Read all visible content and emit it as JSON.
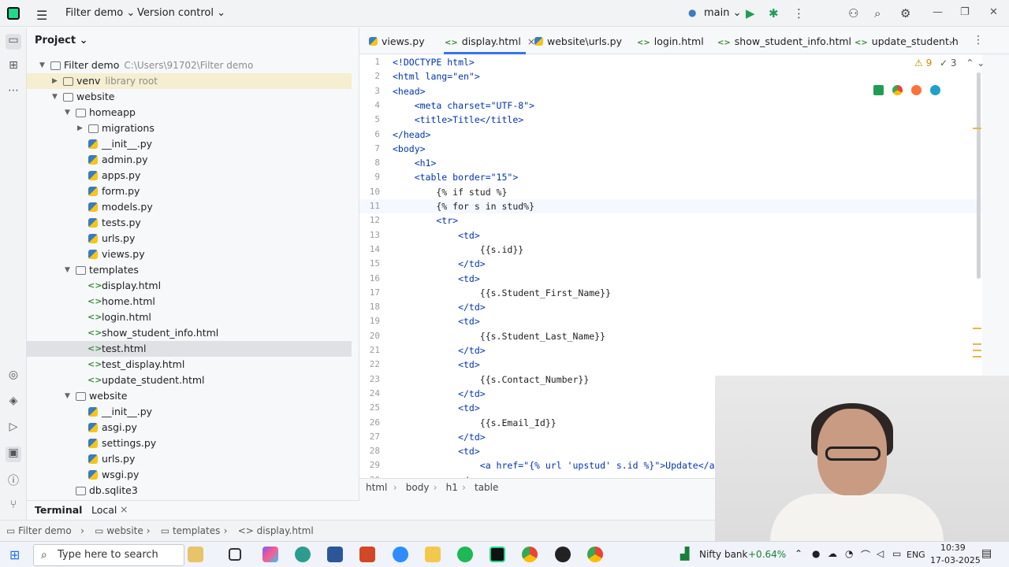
{
  "topbar": {
    "project_menu": "Filter demo ⌄",
    "vcs_menu": "Version control ⌄",
    "branch": "main ⌄"
  },
  "project_panel": {
    "title": "Project ⌄",
    "tree": [
      {
        "label": "Filter demo",
        "hint": "C:\\Users\\91702\\Filter demo",
        "depth": 0,
        "kind": "folder",
        "open": true
      },
      {
        "label": "venv",
        "hint": "library root",
        "depth": 1,
        "kind": "folder",
        "open": false
      },
      {
        "label": "website",
        "hint": "",
        "depth": 1,
        "kind": "folder",
        "open": true
      },
      {
        "label": "homeapp",
        "hint": "",
        "depth": 2,
        "kind": "folder",
        "open": true
      },
      {
        "label": "migrations",
        "hint": "",
        "depth": 3,
        "kind": "folder",
        "open": false
      },
      {
        "label": "__init__.py",
        "hint": "",
        "depth": 3,
        "kind": "py"
      },
      {
        "label": "admin.py",
        "hint": "",
        "depth": 3,
        "kind": "py"
      },
      {
        "label": "apps.py",
        "hint": "",
        "depth": 3,
        "kind": "py"
      },
      {
        "label": "form.py",
        "hint": "",
        "depth": 3,
        "kind": "py"
      },
      {
        "label": "models.py",
        "hint": "",
        "depth": 3,
        "kind": "py"
      },
      {
        "label": "tests.py",
        "hint": "",
        "depth": 3,
        "kind": "py"
      },
      {
        "label": "urls.py",
        "hint": "",
        "depth": 3,
        "kind": "py"
      },
      {
        "label": "views.py",
        "hint": "",
        "depth": 3,
        "kind": "py"
      },
      {
        "label": "templates",
        "hint": "",
        "depth": 2,
        "kind": "folder",
        "open": true
      },
      {
        "label": "display.html",
        "hint": "",
        "depth": 3,
        "kind": "html"
      },
      {
        "label": "home.html",
        "hint": "",
        "depth": 3,
        "kind": "html"
      },
      {
        "label": "login.html",
        "hint": "",
        "depth": 3,
        "kind": "html"
      },
      {
        "label": "show_student_info.html",
        "hint": "",
        "depth": 3,
        "kind": "html"
      },
      {
        "label": "test.html",
        "hint": "",
        "depth": 3,
        "kind": "html",
        "selected": true
      },
      {
        "label": "test_display.html",
        "hint": "",
        "depth": 3,
        "kind": "html"
      },
      {
        "label": "update_student.html",
        "hint": "",
        "depth": 3,
        "kind": "html"
      },
      {
        "label": "website",
        "hint": "",
        "depth": 2,
        "kind": "folder",
        "open": true
      },
      {
        "label": "__init__.py",
        "hint": "",
        "depth": 3,
        "kind": "py"
      },
      {
        "label": "asgi.py",
        "hint": "",
        "depth": 3,
        "kind": "py"
      },
      {
        "label": "settings.py",
        "hint": "",
        "depth": 3,
        "kind": "py"
      },
      {
        "label": "urls.py",
        "hint": "",
        "depth": 3,
        "kind": "py"
      },
      {
        "label": "wsgi.py",
        "hint": "",
        "depth": 3,
        "kind": "py"
      },
      {
        "label": "db.sqlite3",
        "hint": "",
        "depth": 2,
        "kind": "db"
      }
    ]
  },
  "terminal": {
    "title": "Terminal",
    "tab": "Local",
    "close": "×"
  },
  "tabs": [
    {
      "label": "views.py",
      "kind": "py"
    },
    {
      "label": "display.html",
      "kind": "html",
      "active": true,
      "close": "×"
    },
    {
      "label": "website\\urls.py",
      "kind": "py"
    },
    {
      "label": "login.html",
      "kind": "html"
    },
    {
      "label": "show_student_info.html",
      "kind": "html"
    },
    {
      "label": "update_student.h",
      "kind": "html"
    }
  ],
  "inspections": {
    "warnings": "⚠ 9",
    "checks": "✓ 3"
  },
  "code_lines": [
    "<!DOCTYPE html>",
    "<html lang=\"en\">",
    "<head>",
    "    <meta charset=\"UTF-8\">",
    "    <title>Title</title>",
    "</head>",
    "<body>",
    "    <h1>",
    "    <table border=\"15\">",
    "        {% if stud %}",
    "        {% for s in stud%}",
    "        <tr>",
    "            <td>",
    "                {{s.id}}",
    "            </td>",
    "            <td>",
    "                {{s.Student_First_Name}}",
    "            </td>",
    "            <td>",
    "                {{s.Student_Last_Name}}",
    "            </td>",
    "            <td>",
    "                {{s.Contact_Number}}",
    "            </td>",
    "            <td>",
    "                {{s.Email_Id}}",
    "            </td>",
    "            <td>",
    "                <a href=\"{% url 'upstud' s.id %}\">Update</a>",
    "            </"
  ],
  "current_line": 11,
  "breadcrumb": [
    "html",
    "body",
    "h1",
    "table"
  ],
  "status_path": [
    "Filter demo",
    "website",
    "templates",
    "display.html"
  ],
  "taskbar": {
    "search_placeholder": "Type here to search",
    "ticker_name": "Nifty bank",
    "ticker_change": "+0.64%",
    "lang": "ENG",
    "time": "10:39",
    "date": "17-03-2025"
  },
  "colors": {
    "accent": "#3574f0",
    "selection": "#dfe1e5",
    "ticker_up": "#1a7f37"
  }
}
